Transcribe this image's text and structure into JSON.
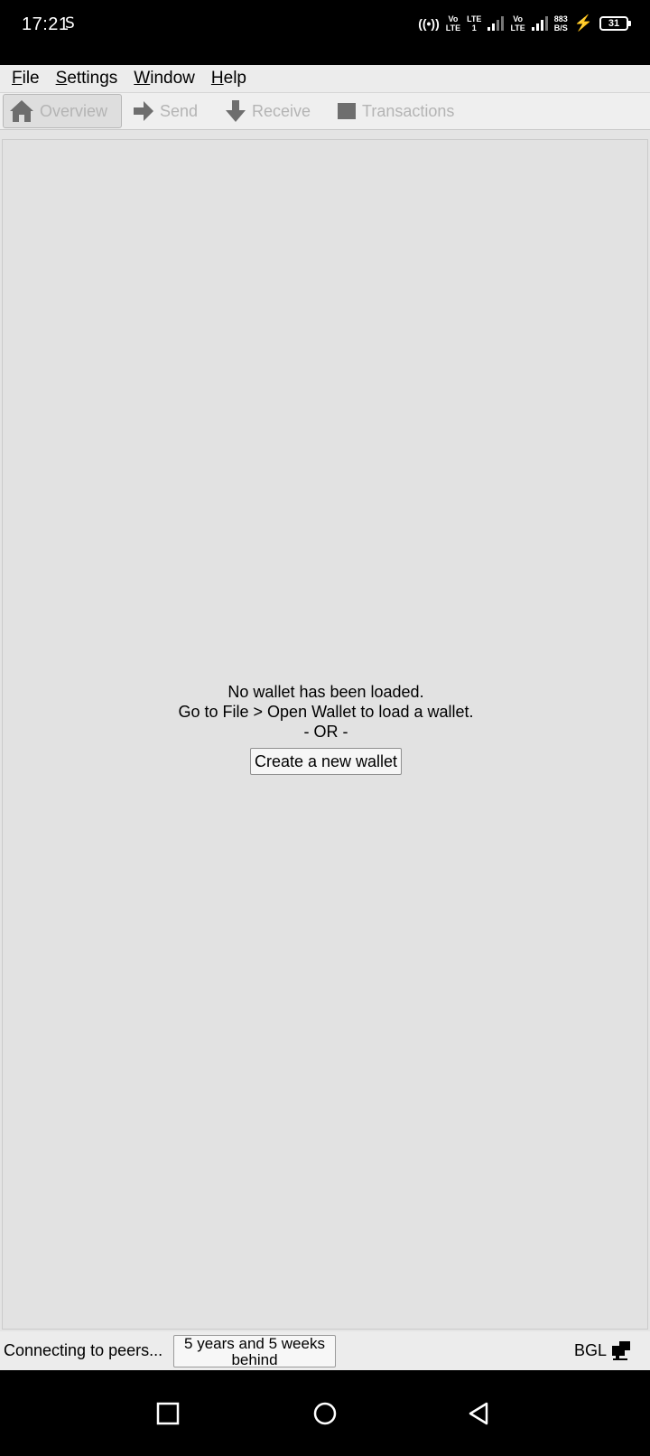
{
  "status_bar": {
    "time": "17:21",
    "notification_icon": "S",
    "hotspot": "((•))",
    "sim1_top": "Vo",
    "sim1_bottom": "LTE",
    "lte_top": "LTE",
    "lte_bottom": "1",
    "sim2_top": "Vo",
    "sim2_bottom": "LTE",
    "speed_top": "883",
    "speed_bottom": "B/S",
    "battery": "31"
  },
  "menubar": {
    "items": [
      {
        "label_u": "F",
        "label_rest": "ile"
      },
      {
        "label_u": "S",
        "label_rest": "ettings"
      },
      {
        "label_u": "W",
        "label_rest": "indow"
      },
      {
        "label_u": "H",
        "label_rest": "elp"
      }
    ]
  },
  "toolbar": {
    "overview": "Overview",
    "send": "Send",
    "receive": "Receive",
    "transactions": "Transactions"
  },
  "main": {
    "line1": "No wallet has been loaded.",
    "line2": "Go to File > Open Wallet to load a wallet.",
    "line3": "- OR -",
    "create_button": "Create a new wallet"
  },
  "statusline": {
    "connecting": "Connecting to peers...",
    "progress_line1": "5 years and 5 weeks",
    "progress_line2": "behind",
    "unit": "BGL"
  },
  "colors": {
    "window_bg": "#e4e4e4",
    "disabled_text": "#b4b4b4",
    "icon_gray": "#6e6e6e"
  }
}
